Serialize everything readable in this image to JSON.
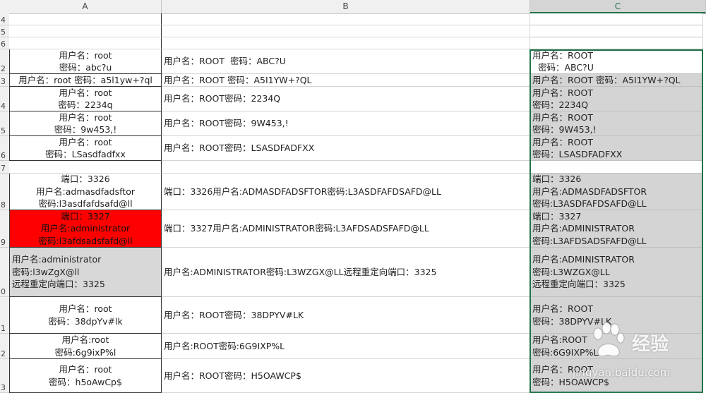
{
  "columns": [
    "A",
    "B",
    "C"
  ],
  "rows": [
    {
      "num": "4",
      "a": "",
      "b": "",
      "c": ""
    },
    {
      "num": "5",
      "a": "",
      "b": "",
      "c": ""
    },
    {
      "num": "6",
      "a": "",
      "b": "",
      "c": ""
    },
    {
      "num": "2",
      "a": "用户名：root\n密码：abc?u",
      "b": "用户名：ROOT  密码：ABC?U",
      "c": "用户名：ROOT\n  密码：ABC?U"
    },
    {
      "num": "3",
      "a": "用户名：root 密码：a5l1yw+?ql",
      "b": "用户名：ROOT 密码：A5I1YW+?QL",
      "c": "用户名：ROOT 密码：A5I1YW+?QL"
    },
    {
      "num": "4",
      "a": "用户名：root\n密码：2234q",
      "b": "用户名：ROOT密码：2234Q",
      "c": "用户名：ROOT\n密码：2234Q"
    },
    {
      "num": "5",
      "a": "用户名：root\n密码：9w453,!",
      "b": "用户名：ROOT密码：9W453,!",
      "c": "用户名：ROOT\n密码：9W453,!"
    },
    {
      "num": "6",
      "a": "用户名：root\n密码：LSasdfadfxx",
      "b": "用户名：ROOT密码：LSASDFADFXX",
      "c": "用户名：ROOT\n密码：LSASDFADFXX"
    },
    {
      "num": "7",
      "a": "",
      "b": "",
      "c": ""
    },
    {
      "num": "8",
      "a": "端口：3326\n用户名:admasdfadsftor\n密码:l3asdfafdsafd@ll",
      "b": "端口：3326用户名:ADMASDFADSFTOR密码:L3ASDFAFDSAFD@LL",
      "c": "端口：3326\n用户名:ADMASDFADSFTOR\n密码:L3ASDFAFDSAFD@LL"
    },
    {
      "num": "9",
      "a": "端口：3327\n用户名:administrator\n密码:l3afdsadsfafd@ll",
      "b": "端口：3327用户名:ADMINISTRATOR密码:L3AFDSADSFAFD@LL",
      "c": "端口：3327\n用户名:ADMINISTRATOR\n密码:L3AFDSADSFAFD@LL"
    },
    {
      "num": "0",
      "a": "用户名:administrator\n密码:l3wZgX@ll\n远程重定向端口：3325",
      "b": "用户名:ADMINISTRATOR密码:L3WZGX@LL远程重定向端口：3325",
      "c": "用户名:ADMINISTRATOR\n密码:L3WZGX@LL\n远程重定向端口：3325"
    },
    {
      "num": "1",
      "a": "用户名：root\n密码：38dpYv#lk",
      "b": "用户名：ROOT密码：38DPYV#LK",
      "c": "用户名：ROOT\n密码：38DPYV#LK"
    },
    {
      "num": "2",
      "a": "用户名:root\n密码:6g9ixP%l",
      "b": "用户名:ROOT密码:6G9IXP%L",
      "c": "用户名:ROOT\n密码:6G9IXP%L"
    },
    {
      "num": "3",
      "a": "用户名：root\n密码：h5oAwCp$",
      "b": "用户名：ROOT密码：H5OAWCP$",
      "c": "用户名：ROOT\n密码：H5OAWCP$"
    }
  ],
  "watermark": {
    "brand": "经验",
    "url": "jingyan.baidu.com"
  },
  "colors": {
    "highlight": "#ff0000",
    "selection": "#217346",
    "filled": "#d4d4d4"
  }
}
